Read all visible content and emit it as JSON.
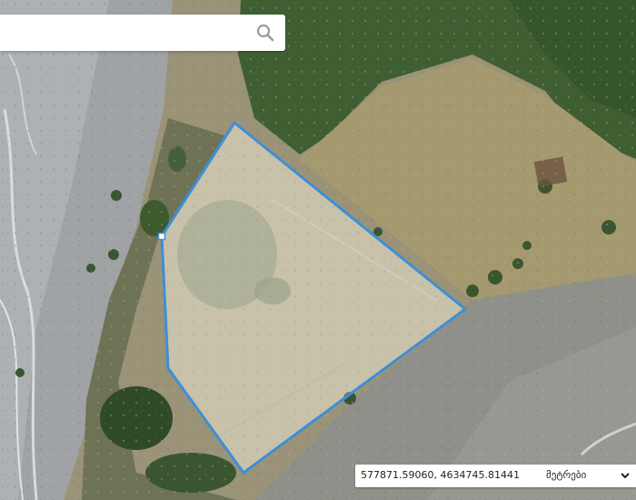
{
  "search": {
    "placeholder": "",
    "value": ""
  },
  "coordinates": {
    "readout": "577871.59060, 4634745.81441",
    "unit_label": "მეტრები"
  },
  "colors": {
    "polygon_stroke": "#3d8fd6",
    "polygon_fill": "rgba(255,255,255,0.22)"
  },
  "icons": {
    "search": "search-icon",
    "unit_dropdown": "chevron-down-icon",
    "vertex_handle": "square-vertex-handle"
  }
}
